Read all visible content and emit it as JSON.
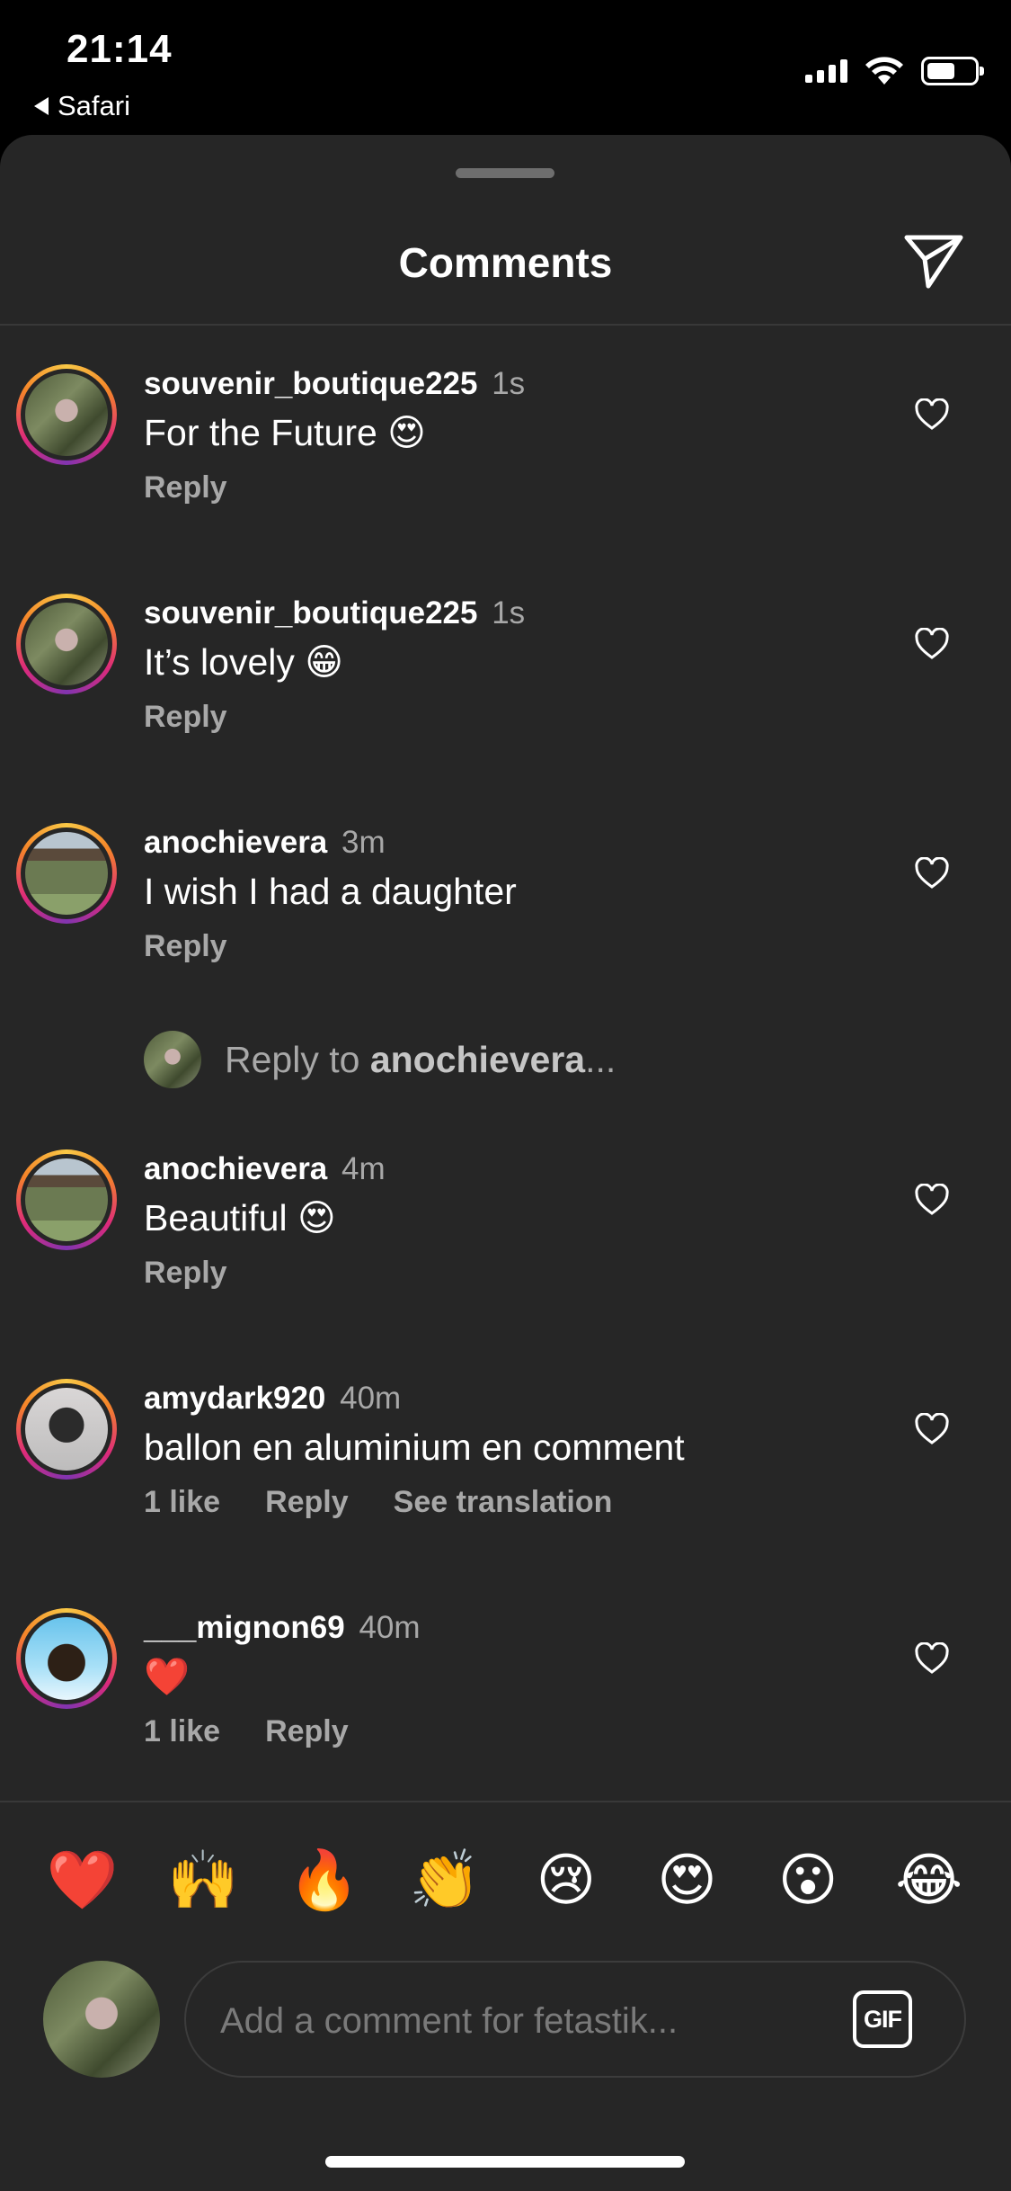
{
  "status_bar": {
    "time": "21:14",
    "back_app": "Safari",
    "battery_level": 0.6
  },
  "sheet": {
    "title": "Comments",
    "send_icon": "paper-plane-icon"
  },
  "comments": [
    {
      "username": "souvenir_boutique225",
      "time": "1s",
      "text": "For the Future 😍",
      "actions": [
        "Reply"
      ]
    },
    {
      "username": "souvenir_boutique225",
      "time": "1s",
      "text": "It’s lovely 😁",
      "actions": [
        "Reply"
      ]
    },
    {
      "username": "anochievera",
      "time": "3m",
      "text": "I wish I had a daughter",
      "actions": [
        "Reply"
      ]
    },
    {
      "username": "anochievera",
      "time": "4m",
      "text": "Beautiful 😍",
      "actions": [
        "Reply"
      ]
    },
    {
      "username": "amydark920",
      "time": "40m",
      "text": "ballon en aluminium en comment",
      "actions": [
        "1 like",
        "Reply",
        "See translation"
      ]
    },
    {
      "username": "___mignon69",
      "time": "40m",
      "text": "❤️",
      "actions": [
        "1 like",
        "Reply"
      ]
    }
  ],
  "reply_prompt": {
    "prefix": "Reply to ",
    "username": "anochievera",
    "suffix": "..."
  },
  "quick_emojis": [
    "❤️",
    "🙌",
    "🔥",
    "👏",
    "😢",
    "😍",
    "😮",
    "😂"
  ],
  "composer": {
    "placeholder": "Add a comment for fetastik...",
    "gif_label": "GIF"
  }
}
